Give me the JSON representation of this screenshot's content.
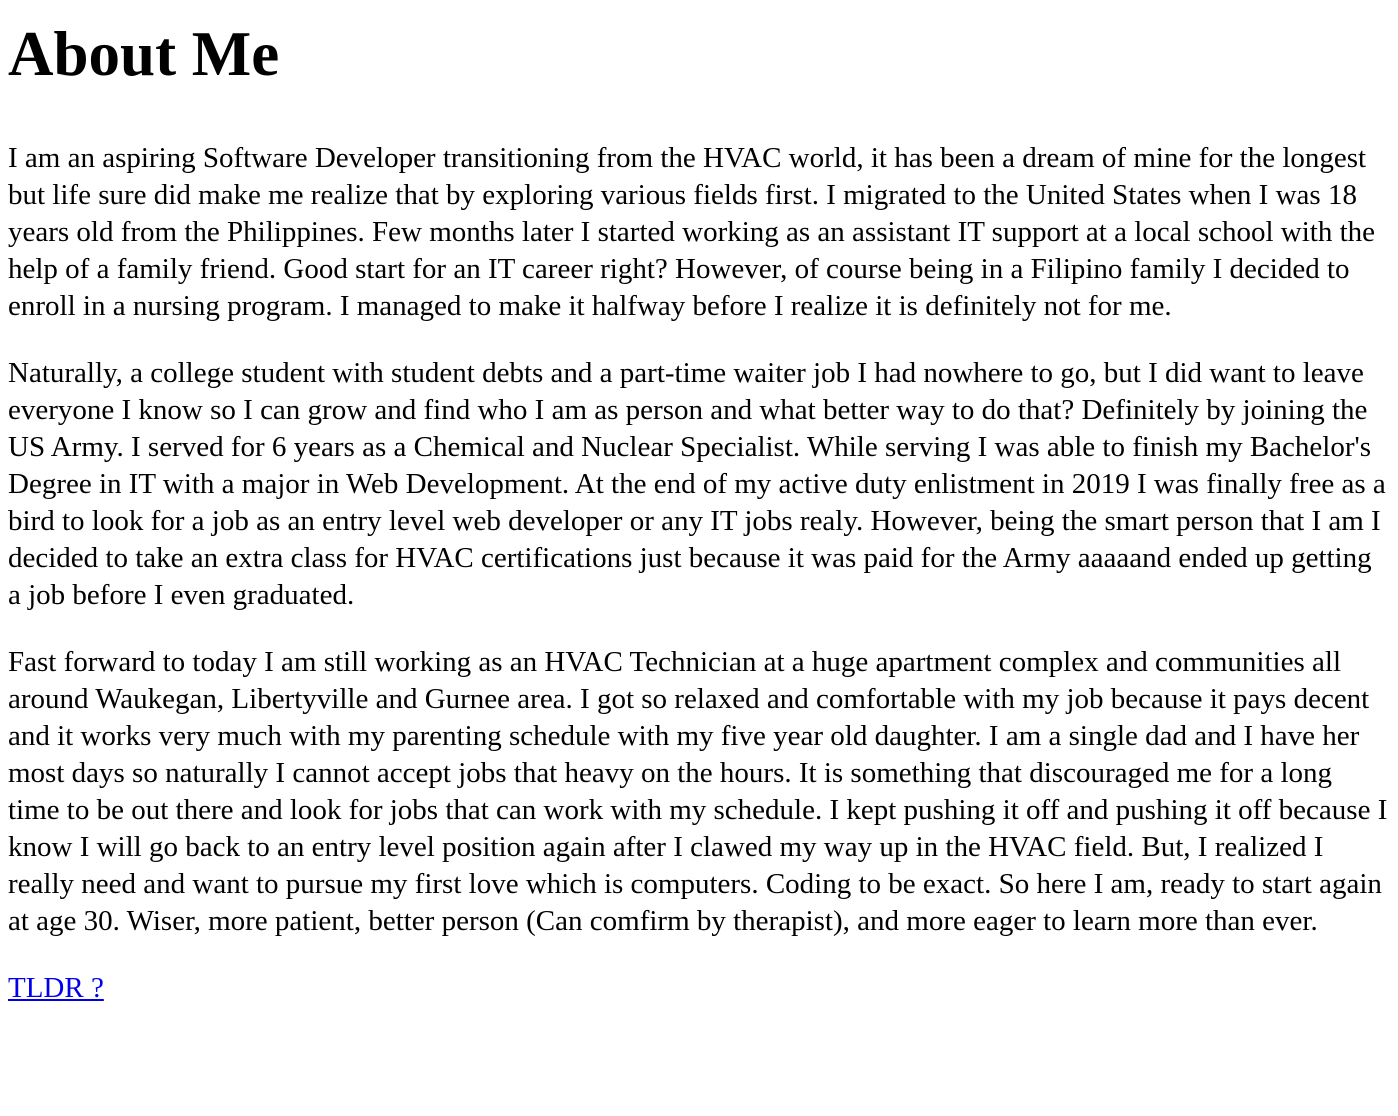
{
  "page": {
    "title": "About Me",
    "paragraphs": [
      "I am an aspiring Software Developer transitioning from the HVAC world, it has been a dream of mine for the longest but life sure did make me realize that by exploring various fields first. I migrated to the United States when I was 18 years old from the Philippines. Few months later I started working as an assistant IT support at a local school with the help of a family friend. Good start for an IT career right? However, of course being in a Filipino family I decided to enroll in a nursing program. I managed to make it halfway before I realize it is definitely not for me.",
      "Naturally, a college student with student debts and a part-time waiter job I had nowhere to go, but I did want to leave everyone I know so I can grow and find who I am as person and what better way to do that? Definitely by joining the US Army. I served for 6 years as a Chemical and Nuclear Specialist. While serving I was able to finish my Bachelor's Degree in IT with a major in Web Development. At the end of my active duty enlistment in 2019 I was finally free as a bird to look for a job as an entry level web developer or any IT jobs realy. However, being the smart person that I am I decided to take an extra class for HVAC certifications just because it was paid for the Army aaaaand ended up getting a job before I even graduated.",
      "Fast forward to today I am still working as an HVAC Technician at a huge apartment complex and communities all around Waukegan, Libertyville and Gurnee area. I got so relaxed and comfortable with my job because it pays decent and it works very much with my parenting schedule with my five year old daughter. I am a single dad and I have her most days so naturally I cannot accept jobs that heavy on the hours. It is something that discouraged me for a long time to be out there and look for jobs that can work with my schedule. I kept pushing it off and pushing it off because I know I will go back to an entry level position again after I clawed my way up in the HVAC field. But, I realized I really need and want to pursue my first love which is computers. Coding to be exact. So here I am, ready to start again at age 30. Wiser, more patient, better person (Can comfirm by therapist), and more eager to learn more than ever."
    ],
    "tldr_link": "TLDR ?"
  },
  "colors": {
    "text": "#000000",
    "link": "#0000ee",
    "background": "#ffffff"
  }
}
